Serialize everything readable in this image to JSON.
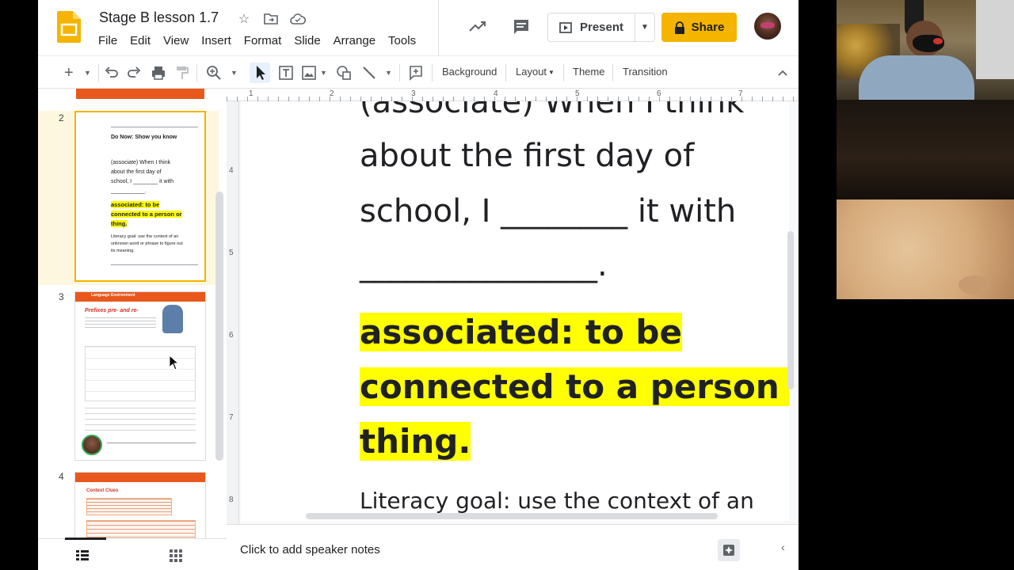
{
  "doc": {
    "title": "Stage B lesson 1.7"
  },
  "menu": [
    "File",
    "Edit",
    "View",
    "Insert",
    "Format",
    "Slide",
    "Arrange",
    "Tools"
  ],
  "header": {
    "present_label": "Present",
    "share_label": "Share"
  },
  "toolbar": {
    "background": "Background",
    "layout": "Layout",
    "theme": "Theme",
    "transition": "Transition"
  },
  "filmstrip": {
    "slides": [
      {
        "num": "2",
        "title": "Do Now: Show you know",
        "line1": "(associate) When I think",
        "line2": "about the first day of",
        "line3": "school, I ________ it with",
        "line4": "___________.",
        "def1": "associated: to be",
        "def2": "connected to a person or",
        "def3": "thing.",
        "goal1": "Literacy goal: use the context of an",
        "goal2": "unknown word or phrase to figure out",
        "goal3": "its meaning."
      },
      {
        "num": "3",
        "header": "Language Environment",
        "title": "Prefixes pre- and re-"
      },
      {
        "num": "4",
        "title": "Context Clues"
      }
    ]
  },
  "ruler": {
    "h": [
      "1",
      "2",
      "3",
      "4",
      "5",
      "6",
      "7"
    ],
    "v": [
      "4",
      "5",
      "6",
      "7",
      "8"
    ]
  },
  "slide": {
    "line0": "(associate) When I think",
    "line1": "about the first day of",
    "line2": "school, I ________ it with",
    "line3": "_______________.",
    "def1": "associated: to be",
    "def2": "connected to a person or",
    "def3": "thing.",
    "goal": "Literacy goal: use the context of an"
  },
  "notes": {
    "placeholder": "Click to add speaker notes"
  },
  "colors": {
    "accent": "#f4b400",
    "highlight": "#ffff00",
    "thumb_header": "#e8581c"
  }
}
